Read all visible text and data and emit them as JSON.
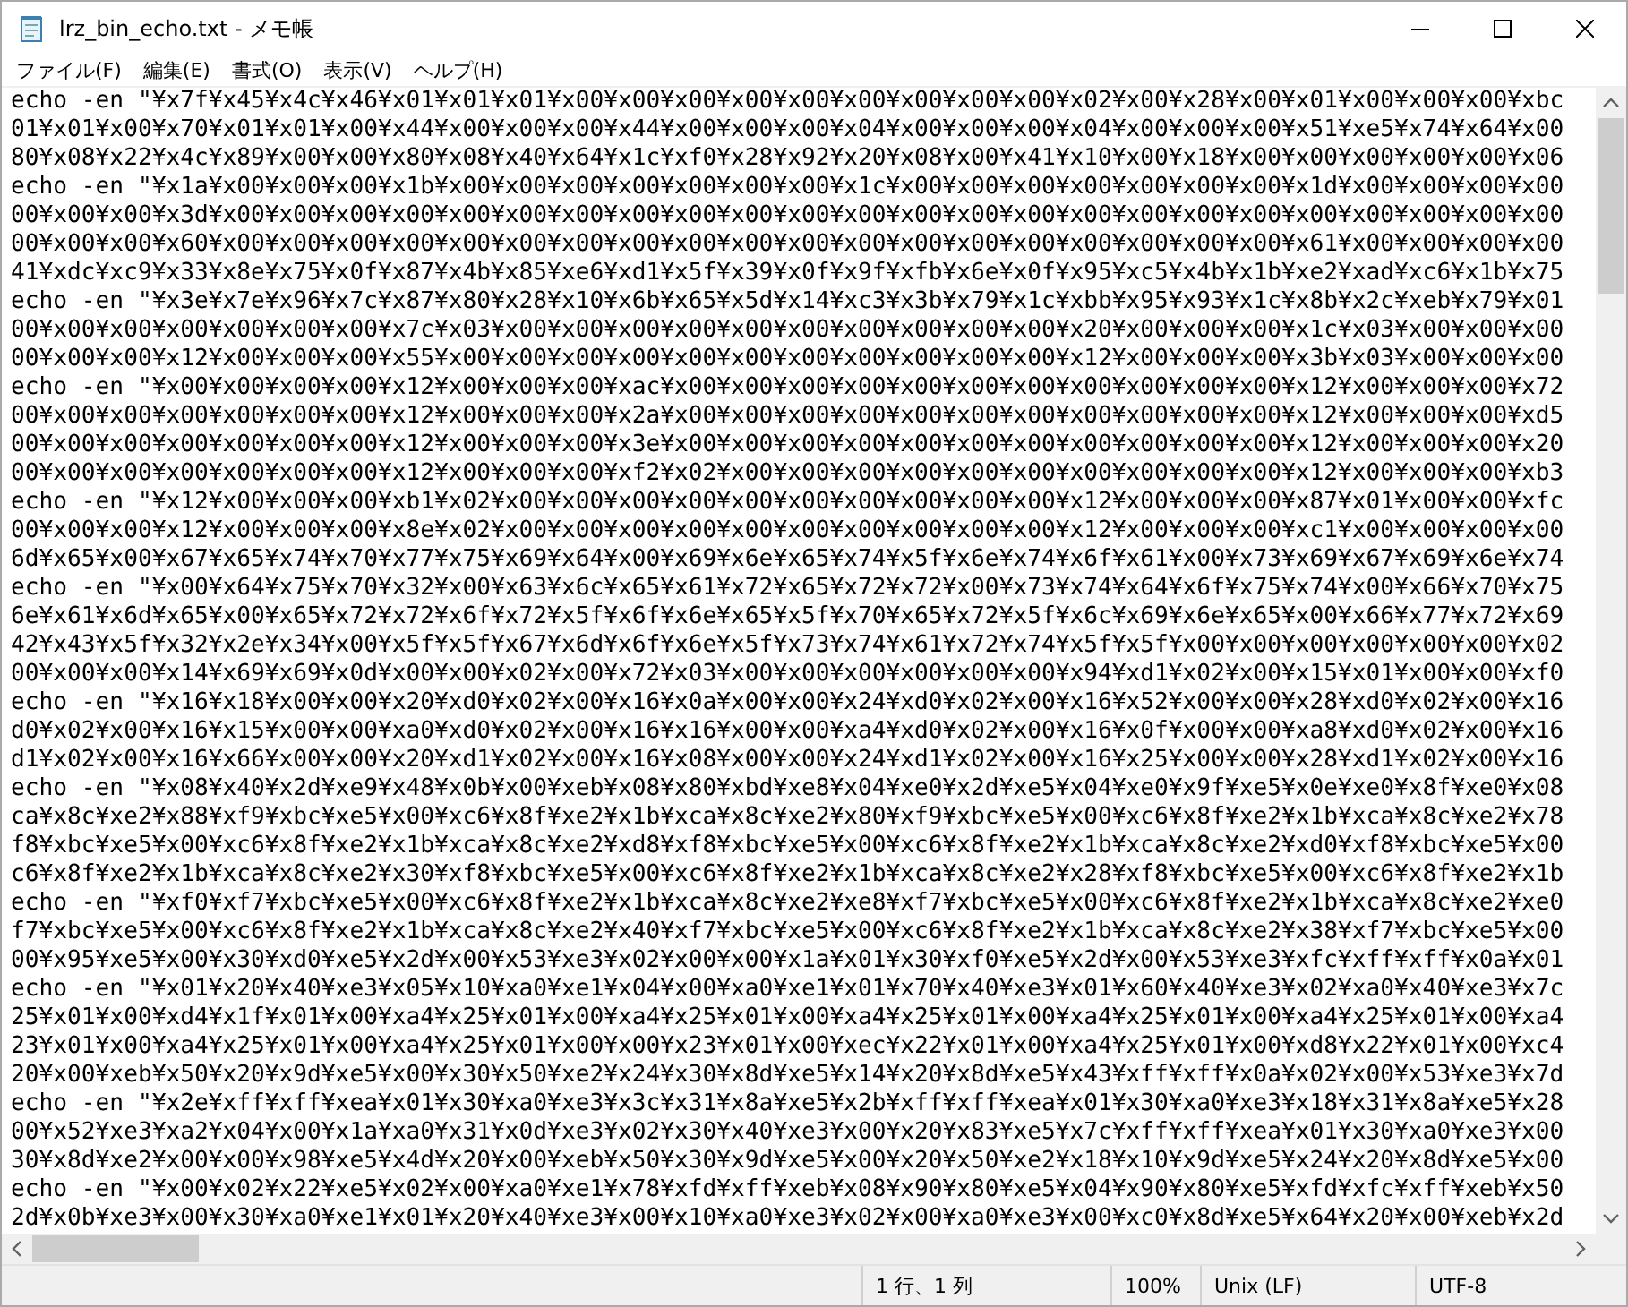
{
  "window": {
    "title": "lrz_bin_echo.txt - メモ帳"
  },
  "menu": [
    "ファイル(F)",
    "編集(E)",
    "書式(O)",
    "表示(V)",
    "ヘルプ(H)"
  ],
  "lines": [
    "echo -en \"¥x7f¥x45¥x4c¥x46¥x01¥x01¥x01¥x00¥x00¥x00¥x00¥x00¥x00¥x00¥x00¥x00¥x02¥x00¥x28¥x00¥x01¥x00¥x00¥x00¥xbc",
    "01¥x01¥x00¥x70¥x01¥x01¥x00¥x44¥x00¥x00¥x00¥x44¥x00¥x00¥x00¥x04¥x00¥x00¥x00¥x04¥x00¥x00¥x00¥x51¥xe5¥x74¥x64¥x00",
    "80¥x08¥x22¥x4c¥x89¥x00¥x00¥x80¥x08¥x40¥x64¥x1c¥xf0¥x28¥x92¥x20¥x08¥x00¥x41¥x10¥x00¥x18¥x00¥x00¥x00¥x00¥x00¥x06",
    "echo -en \"¥x1a¥x00¥x00¥x00¥x1b¥x00¥x00¥x00¥x00¥x00¥x00¥x00¥x1c¥x00¥x00¥x00¥x00¥x00¥x00¥x00¥x1d¥x00¥x00¥x00¥x00",
    "00¥x00¥x00¥x3d¥x00¥x00¥x00¥x00¥x00¥x00¥x00¥x00¥x00¥x00¥x00¥x00¥x00¥x00¥x00¥x00¥x00¥x00¥x00¥x00¥x00¥x00¥x00¥x00",
    "00¥x00¥x00¥x60¥x00¥x00¥x00¥x00¥x00¥x00¥x00¥x00¥x00¥x00¥x00¥x00¥x00¥x00¥x00¥x00¥x00¥x00¥x00¥x61¥x00¥x00¥x00¥x00",
    "41¥xdc¥xc9¥x33¥x8e¥x75¥x0f¥x87¥x4b¥x85¥xe6¥xd1¥x5f¥x39¥x0f¥x9f¥xfb¥x6e¥x0f¥x95¥xc5¥x4b¥x1b¥xe2¥xad¥xc6¥x1b¥x75",
    "echo -en \"¥x3e¥x7e¥x96¥x7c¥x87¥x80¥x28¥x10¥x6b¥x65¥x5d¥x14¥xc3¥x3b¥x79¥x1c¥xbb¥x95¥x93¥x1c¥x8b¥x2c¥xeb¥x79¥x01",
    "00¥x00¥x00¥x00¥x00¥x00¥x00¥x7c¥x03¥x00¥x00¥x00¥x00¥x00¥x00¥x00¥x00¥x00¥x00¥x20¥x00¥x00¥x00¥x1c¥x03¥x00¥x00¥x00",
    "00¥x00¥x00¥x12¥x00¥x00¥x00¥x55¥x00¥x00¥x00¥x00¥x00¥x00¥x00¥x00¥x00¥x00¥x00¥x12¥x00¥x00¥x00¥x3b¥x03¥x00¥x00¥x00",
    "echo -en \"¥x00¥x00¥x00¥x00¥x12¥x00¥x00¥x00¥xac¥x00¥x00¥x00¥x00¥x00¥x00¥x00¥x00¥x00¥x00¥x00¥x12¥x00¥x00¥x00¥x72",
    "00¥x00¥x00¥x00¥x00¥x00¥x00¥x12¥x00¥x00¥x00¥x2a¥x00¥x00¥x00¥x00¥x00¥x00¥x00¥x00¥x00¥x00¥x00¥x12¥x00¥x00¥x00¥xd5",
    "00¥x00¥x00¥x00¥x00¥x00¥x00¥x12¥x00¥x00¥x00¥x3e¥x00¥x00¥x00¥x00¥x00¥x00¥x00¥x00¥x00¥x00¥x00¥x12¥x00¥x00¥x00¥x20",
    "00¥x00¥x00¥x00¥x00¥x00¥x00¥x12¥x00¥x00¥x00¥xf2¥x02¥x00¥x00¥x00¥x00¥x00¥x00¥x00¥x00¥x00¥x00¥x12¥x00¥x00¥x00¥xb3",
    "echo -en \"¥x12¥x00¥x00¥x00¥xb1¥x02¥x00¥x00¥x00¥x00¥x00¥x00¥x00¥x00¥x00¥x00¥x12¥x00¥x00¥x00¥x87¥x01¥x00¥x00¥xfc",
    "00¥x00¥x00¥x12¥x00¥x00¥x00¥x8e¥x02¥x00¥x00¥x00¥x00¥x00¥x00¥x00¥x00¥x00¥x00¥x12¥x00¥x00¥x00¥xc1¥x00¥x00¥x00¥x00",
    "6d¥x65¥x00¥x67¥x65¥x74¥x70¥x77¥x75¥x69¥x64¥x00¥x69¥x6e¥x65¥x74¥x5f¥x6e¥x74¥x6f¥x61¥x00¥x73¥x69¥x67¥x69¥x6e¥x74",
    "echo -en \"¥x00¥x64¥x75¥x70¥x32¥x00¥x63¥x6c¥x65¥x61¥x72¥x65¥x72¥x72¥x00¥x73¥x74¥x64¥x6f¥x75¥x74¥x00¥x66¥x70¥x75",
    "6e¥x61¥x6d¥x65¥x00¥x65¥x72¥x72¥x6f¥x72¥x5f¥x6f¥x6e¥x65¥x5f¥x70¥x65¥x72¥x5f¥x6c¥x69¥x6e¥x65¥x00¥x66¥x77¥x72¥x69",
    "42¥x43¥x5f¥x32¥x2e¥x34¥x00¥x5f¥x5f¥x67¥x6d¥x6f¥x6e¥x5f¥x73¥x74¥x61¥x72¥x74¥x5f¥x5f¥x00¥x00¥x00¥x00¥x00¥x00¥x02",
    "00¥x00¥x00¥x14¥x69¥x69¥x0d¥x00¥x00¥x02¥x00¥x72¥x03¥x00¥x00¥x00¥x00¥x00¥x00¥x94¥xd1¥x02¥x00¥x15¥x01¥x00¥x00¥xf0",
    "echo -en \"¥x16¥x18¥x00¥x00¥x20¥xd0¥x02¥x00¥x16¥x0a¥x00¥x00¥x24¥xd0¥x02¥x00¥x16¥x52¥x00¥x00¥x28¥xd0¥x02¥x00¥x16",
    "d0¥x02¥x00¥x16¥x15¥x00¥x00¥xa0¥xd0¥x02¥x00¥x16¥x16¥x00¥x00¥xa4¥xd0¥x02¥x00¥x16¥x0f¥x00¥x00¥xa8¥xd0¥x02¥x00¥x16",
    "d1¥x02¥x00¥x16¥x66¥x00¥x00¥x20¥xd1¥x02¥x00¥x16¥x08¥x00¥x00¥x24¥xd1¥x02¥x00¥x16¥x25¥x00¥x00¥x28¥xd1¥x02¥x00¥x16",
    "echo -en \"¥x08¥x40¥x2d¥xe9¥x48¥x0b¥x00¥xeb¥x08¥x80¥xbd¥xe8¥x04¥xe0¥x2d¥xe5¥x04¥xe0¥x9f¥xe5¥x0e¥xe0¥x8f¥xe0¥x08",
    "ca¥x8c¥xe2¥x88¥xf9¥xbc¥xe5¥x00¥xc6¥x8f¥xe2¥x1b¥xca¥x8c¥xe2¥x80¥xf9¥xbc¥xe5¥x00¥xc6¥x8f¥xe2¥x1b¥xca¥x8c¥xe2¥x78",
    "f8¥xbc¥xe5¥x00¥xc6¥x8f¥xe2¥x1b¥xca¥x8c¥xe2¥xd8¥xf8¥xbc¥xe5¥x00¥xc6¥x8f¥xe2¥x1b¥xca¥x8c¥xe2¥xd0¥xf8¥xbc¥xe5¥x00",
    "c6¥x8f¥xe2¥x1b¥xca¥x8c¥xe2¥x30¥xf8¥xbc¥xe5¥x00¥xc6¥x8f¥xe2¥x1b¥xca¥x8c¥xe2¥x28¥xf8¥xbc¥xe5¥x00¥xc6¥x8f¥xe2¥x1b",
    "echo -en \"¥xf0¥xf7¥xbc¥xe5¥x00¥xc6¥x8f¥xe2¥x1b¥xca¥x8c¥xe2¥xe8¥xf7¥xbc¥xe5¥x00¥xc6¥x8f¥xe2¥x1b¥xca¥x8c¥xe2¥xe0",
    "f7¥xbc¥xe5¥x00¥xc6¥x8f¥xe2¥x1b¥xca¥x8c¥xe2¥x40¥xf7¥xbc¥xe5¥x00¥xc6¥x8f¥xe2¥x1b¥xca¥x8c¥xe2¥x38¥xf7¥xbc¥xe5¥x00",
    "00¥x95¥xe5¥x00¥x30¥xd0¥xe5¥x2d¥x00¥x53¥xe3¥x02¥x00¥x00¥x1a¥x01¥x30¥xf0¥xe5¥x2d¥x00¥x53¥xe3¥xfc¥xff¥xff¥x0a¥x01",
    "echo -en \"¥x01¥x20¥x40¥xe3¥x05¥x10¥xa0¥xe1¥x04¥x00¥xa0¥xe1¥x01¥x70¥x40¥xe3¥x01¥x60¥x40¥xe3¥x02¥xa0¥x40¥xe3¥x7c",
    "25¥x01¥x00¥xd4¥x1f¥x01¥x00¥xa4¥x25¥x01¥x00¥xa4¥x25¥x01¥x00¥xa4¥x25¥x01¥x00¥xa4¥x25¥x01¥x00¥xa4¥x25¥x01¥x00¥xa4",
    "23¥x01¥x00¥xa4¥x25¥x01¥x00¥xa4¥x25¥x01¥x00¥x00¥x23¥x01¥x00¥xec¥x22¥x01¥x00¥xa4¥x25¥x01¥x00¥xd8¥x22¥x01¥x00¥xc4",
    "20¥x00¥xeb¥x50¥x20¥x9d¥xe5¥x00¥x30¥x50¥xe2¥x24¥x30¥x8d¥xe5¥x14¥x20¥x8d¥xe5¥x43¥xff¥xff¥x0a¥x02¥x00¥x53¥xe3¥x7d",
    "echo -en \"¥x2e¥xff¥xff¥xea¥x01¥x30¥xa0¥xe3¥x3c¥x31¥x8a¥xe5¥x2b¥xff¥xff¥xea¥x01¥x30¥xa0¥xe3¥x18¥x31¥x8a¥xe5¥x28",
    "00¥x52¥xe3¥xa2¥x04¥x00¥x1a¥xa0¥x31¥x0d¥xe3¥x02¥x30¥x40¥xe3¥x00¥x20¥x83¥xe5¥x7c¥xff¥xff¥xea¥x01¥x30¥xa0¥xe3¥x00",
    "30¥x8d¥xe2¥x00¥x00¥x98¥xe5¥x4d¥x20¥x00¥xeb¥x50¥x30¥x9d¥xe5¥x00¥x20¥x50¥xe2¥x18¥x10¥x9d¥xe5¥x24¥x20¥x8d¥xe5¥x00",
    "echo -en \"¥x00¥x02¥x22¥xe5¥x02¥x00¥xa0¥xe1¥x78¥xfd¥xff¥xeb¥x08¥x90¥x80¥xe5¥x04¥x90¥x80¥xe5¥xfd¥xfc¥xff¥xeb¥x50",
    "2d¥x0b¥xe3¥x00¥x30¥xa0¥xe1¥x01¥x20¥x40¥xe3¥x00¥x10¥xa0¥xe3¥x02¥x00¥xa0¥xe3¥x00¥xc0¥x8d¥xe5¥x64¥x20¥x00¥xeb¥x2d"
  ],
  "status_bar": [
    "1 行、1 列",
    "100%",
    "Unix (LF)",
    "UTF-8"
  ]
}
